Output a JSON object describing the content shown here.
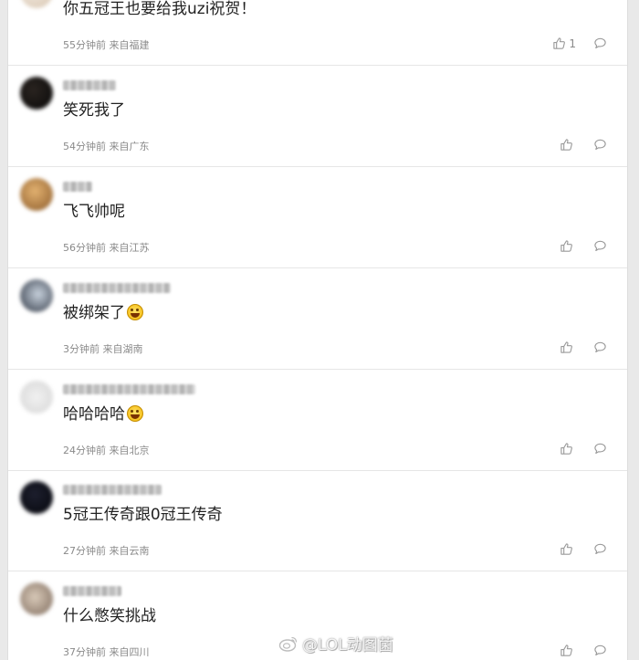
{
  "comments": [
    {
      "text": "你五冠王也要给我uzi祝贺！",
      "time": "55分钟前",
      "location": "来自福建",
      "likes": "1",
      "avatar_colors": [
        "#f1e8de",
        "#d9c7b2"
      ],
      "emoji": false
    },
    {
      "text": "笑死我了",
      "time": "54分钟前",
      "location": "来自广东",
      "likes": "",
      "avatar_colors": [
        "#2a2420",
        "#080808"
      ],
      "emoji": false
    },
    {
      "text": "飞飞帅呢",
      "time": "56分钟前",
      "location": "来自江苏",
      "likes": "",
      "avatar_colors": [
        "#e2b170",
        "#8a5a2a"
      ],
      "emoji": false
    },
    {
      "text": "被绑架了",
      "time": "3分钟前",
      "location": "来自湖南",
      "likes": "",
      "avatar_colors": [
        "#c7d1dc",
        "#2c3340"
      ],
      "emoji": true
    },
    {
      "text": "哈哈哈哈",
      "time": "24分钟前",
      "location": "来自北京",
      "likes": "",
      "avatar_colors": [
        "#f1f1f1",
        "#d6d6d6"
      ],
      "emoji": true
    },
    {
      "text": "5冠王传奇跟0冠王传奇",
      "time": "27分钟前",
      "location": "来自云南",
      "likes": "",
      "avatar_colors": [
        "#1d1f2e",
        "#05060b"
      ],
      "emoji": false
    },
    {
      "text": "什么憋笑挑战",
      "time": "37分钟前",
      "location": "来自四川",
      "likes": "",
      "avatar_colors": [
        "#d8c9b8",
        "#7d6a5c"
      ],
      "emoji": false
    }
  ],
  "watermark": "@LOL动图菌"
}
